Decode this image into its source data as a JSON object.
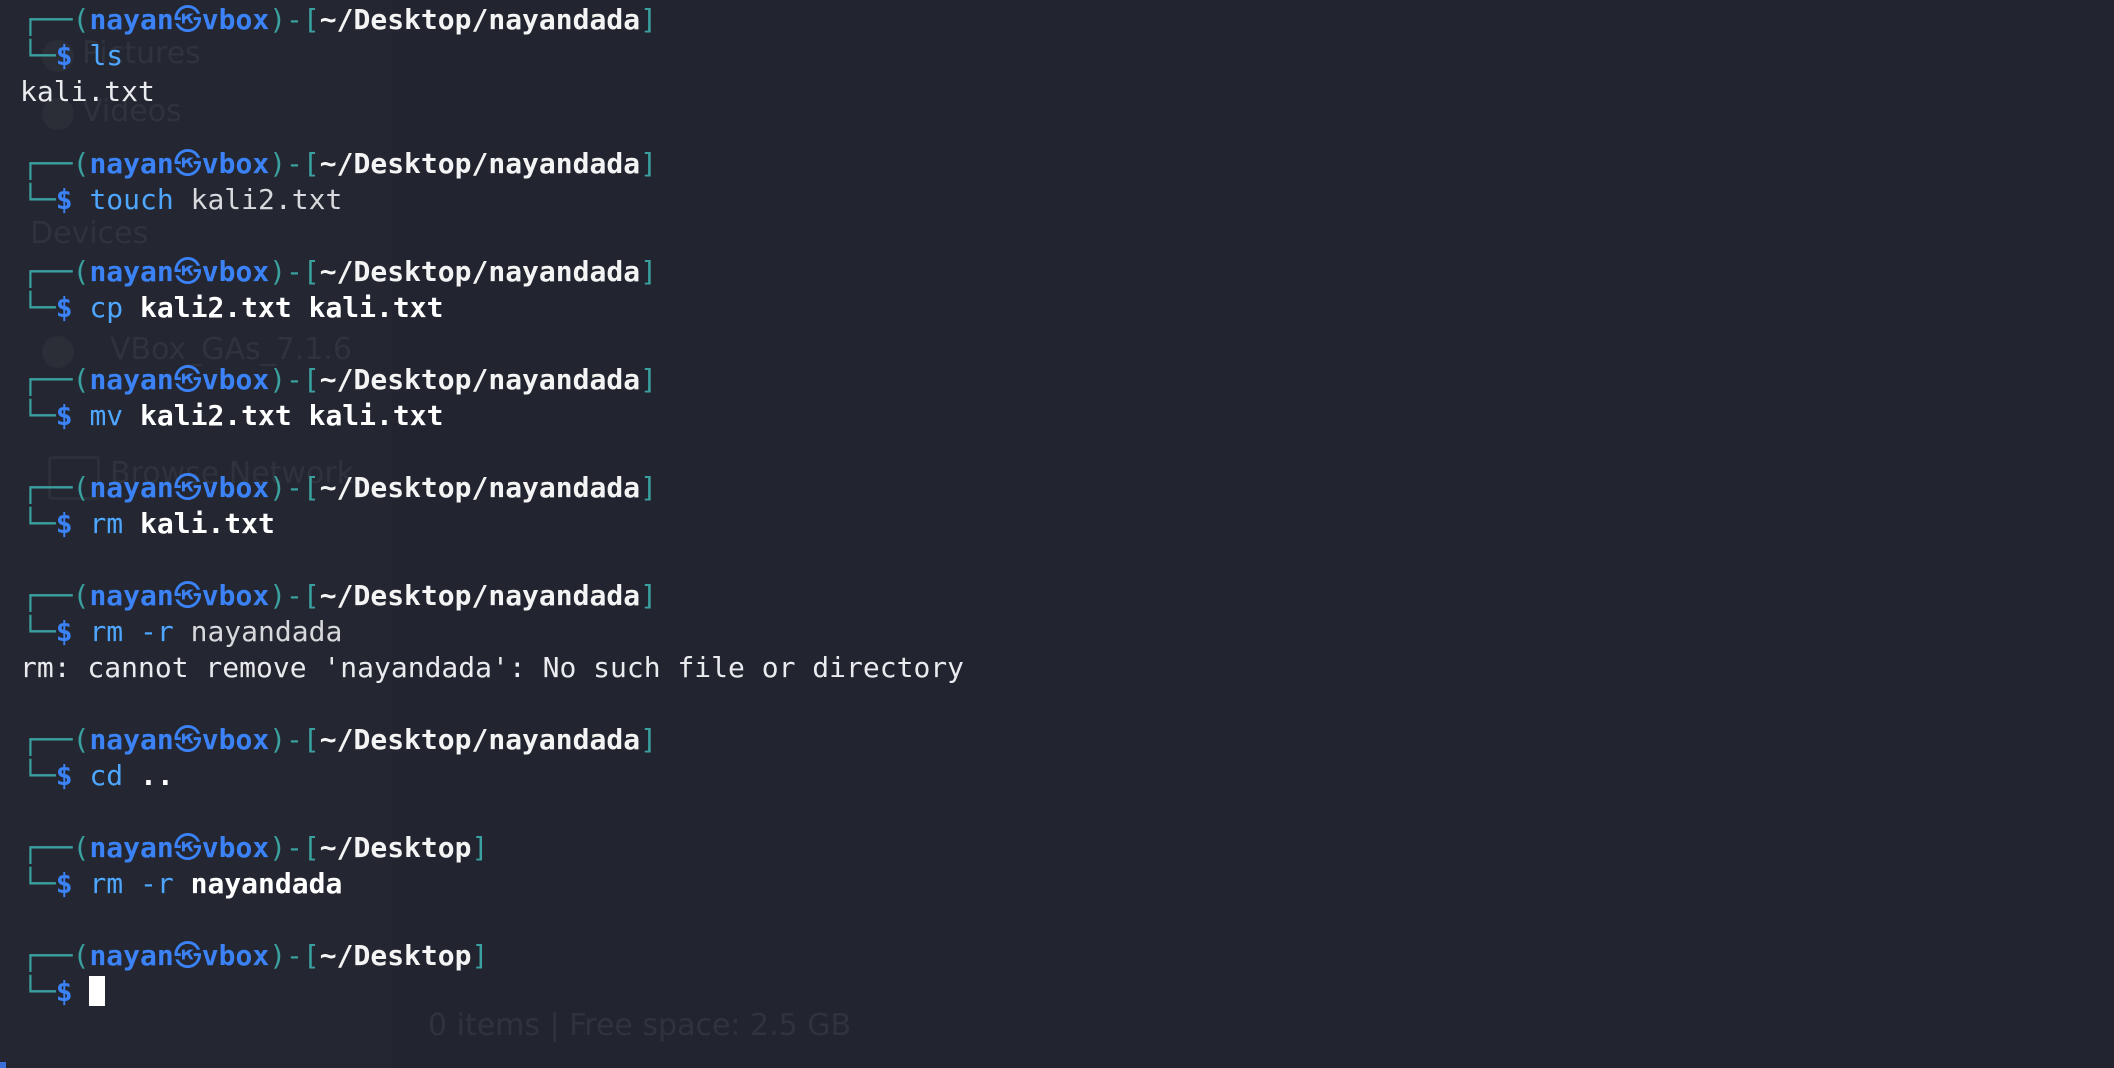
{
  "ghost": {
    "pictures": "Pictures",
    "videos": "Videos",
    "devices": "Devices",
    "vbox": "VBox_GAs_7.1.6",
    "network": "Browse Network",
    "status": "0 items | Free space: 2.5 GB"
  },
  "prompt": {
    "user": "nayan",
    "at_symbol": "㉿",
    "host": "vbox",
    "dollar": "$"
  },
  "blocks": [
    {
      "path": "~/Desktop/nayandada",
      "cmd": "ls",
      "args": [],
      "output": [
        "kali.txt"
      ]
    },
    {
      "path": "~/Desktop/nayandada",
      "cmd": "touch",
      "args": [
        {
          "text": "kali2.txt",
          "bold": false
        }
      ],
      "output": []
    },
    {
      "path": "~/Desktop/nayandada",
      "cmd": "cp",
      "args": [
        {
          "text": "kali2.txt",
          "bold": true
        },
        {
          "text": "kali.txt",
          "bold": true
        }
      ],
      "output": []
    },
    {
      "path": "~/Desktop/nayandada",
      "cmd": "mv",
      "args": [
        {
          "text": "kali2.txt",
          "bold": true
        },
        {
          "text": "kali.txt",
          "bold": true
        }
      ],
      "output": []
    },
    {
      "path": "~/Desktop/nayandada",
      "cmd": "rm",
      "args": [
        {
          "text": "kali.txt",
          "bold": true
        }
      ],
      "output": []
    },
    {
      "path": "~/Desktop/nayandada",
      "cmd": "rm",
      "args": [
        {
          "text": "-r",
          "bold": false,
          "flag": true
        },
        {
          "text": "nayandada",
          "bold": false
        }
      ],
      "output": [
        "rm: cannot remove 'nayandada': No such file or directory"
      ]
    },
    {
      "path": "~/Desktop/nayandada",
      "cmd": "cd",
      "args": [
        {
          "text": "..",
          "bold": true
        }
      ],
      "output": []
    },
    {
      "path": "~/Desktop",
      "cmd": "rm",
      "args": [
        {
          "text": "-r",
          "bold": false,
          "flag": true
        },
        {
          "text": "nayandada",
          "bold": true
        }
      ],
      "output": []
    },
    {
      "path": "~/Desktop",
      "cmd": "",
      "args": [],
      "output": [],
      "active": true
    }
  ]
}
